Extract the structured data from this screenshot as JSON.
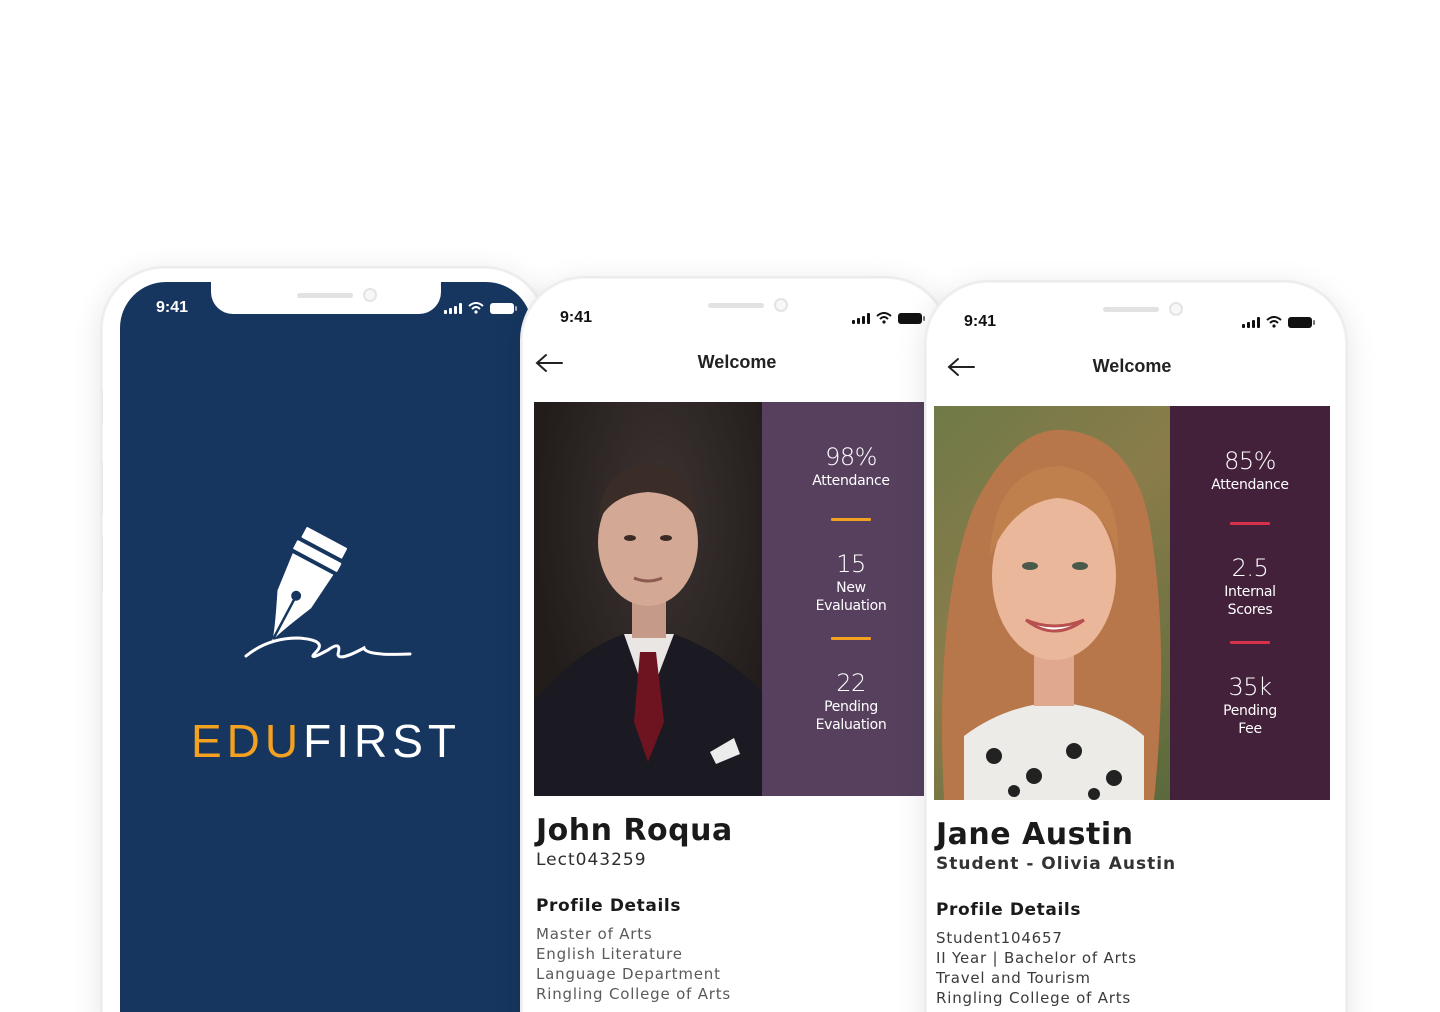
{
  "status_bar": {
    "time": "9:41"
  },
  "splash": {
    "brand_part1": "EDU",
    "brand_part2": "FIRST",
    "background": "#16365f",
    "accent": "#f2a120",
    "logo_icon": "fountain-pen-icon"
  },
  "lecturer_screen": {
    "title": "Welcome",
    "back_icon": "arrow-left-icon",
    "panel_color": "#56405e",
    "divider_color": "#f2a120",
    "stats": [
      {
        "value": "98%",
        "label": "Attendance"
      },
      {
        "value": "15",
        "label": "New\nEvaluation"
      },
      {
        "value": "22",
        "label": "Pending\nEvaluation"
      }
    ],
    "name": "John Roqua",
    "id": "Lect043259",
    "details_heading": "Profile Details",
    "details": [
      "Master of Arts",
      "English Literature",
      "Language Department",
      "Ringling College of Arts"
    ]
  },
  "student_screen": {
    "title": "Welcome",
    "back_icon": "arrow-left-icon",
    "panel_color": "#43213a",
    "divider_color": "#d8324a",
    "stats": [
      {
        "value": "85%",
        "label": "Attendance"
      },
      {
        "value": "2.5",
        "label": "Internal\nScores"
      },
      {
        "value": "35k",
        "label": "Pending\nFee"
      }
    ],
    "name": "Jane Austin",
    "subtitle": "Student - Olivia Austin",
    "details_heading": "Profile Details",
    "details": [
      "Student104657",
      "II Year | Bachelor of Arts",
      "Travel and Tourism",
      "Ringling College of Arts"
    ]
  }
}
